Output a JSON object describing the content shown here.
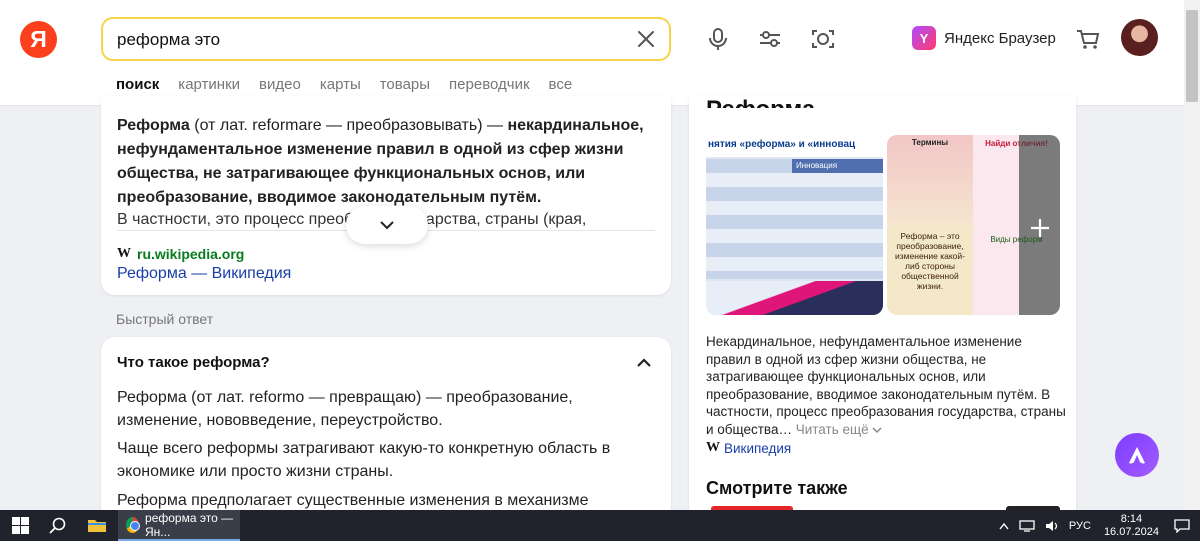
{
  "header": {
    "logo": "Я",
    "search_value": "реформа это",
    "browser_link": "Яндекс Браузер",
    "browser_icon_letter": "Y"
  },
  "tabs": [
    "поиск",
    "картинки",
    "видео",
    "карты",
    "товары",
    "переводчик",
    "все"
  ],
  "result": {
    "term": "Реформа",
    "def_mid": " (от лат. reformare — преобразовывать) — ",
    "def_bold": "некардинальное, нефундаментальное изменение правил в одной из сфер жизни общества, не затрагивающее функциональных основ, или преобразование, вводимое законодательным путём.",
    "more": "В частности, это процесс преоб… я государства, страны (края,",
    "source_domain": "ru.wikipedia.org",
    "source_title": "Реформа — Википедия"
  },
  "quick_answer_label": "Быстрый ответ",
  "faq": {
    "question": "Что такое реформа?",
    "p1": "Реформа (от лат. reformo — превращаю) — преобразование, изменение, нововведение, переустройство.",
    "p2": "Чаще всего реформы затрагивают какую-то конкретную область в экономике или просто жизни страны.",
    "p3": "Реформа предполагает существенные изменения в механизме"
  },
  "knowledge": {
    "title": "Реформа",
    "description": "Некардинальное, нефундаментальное изменение правил в одной из сфер жизни общества, не затрагивающее функциональных основ, или преобразование, вводимое законодательным путём. В частности, процесс преобразования государства, страны и общества…",
    "read_more": "Читать ещё",
    "source": "Википедия",
    "see_also": "Смотрите также",
    "image_a_title": "нятия «реформа» и «инновац",
    "image_a_col": "Инновация",
    "image_b_heading": "Термины",
    "image_b_caption": "Реформа – это преобразование, изменение какой-либ стороны общественной жизни.",
    "image_c_heading": "Найди отличия!",
    "image_c_caption": "Виды реформ"
  },
  "taskbar": {
    "app_title": "реформа это — Ян...",
    "lang": "РУС",
    "time": "8:14",
    "date": "16.07.2024"
  },
  "colors": {
    "accent_yellow": "#f6d44a",
    "logo_red": "#fc3f1d",
    "link_blue": "#1a3ea8",
    "source_green": "#0a7a1f",
    "alice_purple": "#7b3cff"
  }
}
